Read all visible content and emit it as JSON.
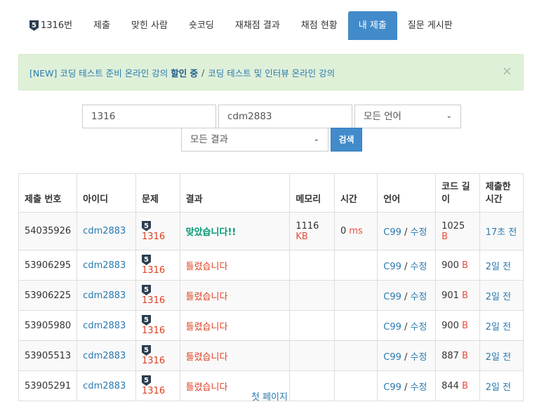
{
  "tabs": [
    {
      "label": "1316번",
      "badge": "5"
    },
    {
      "label": "제출"
    },
    {
      "label": "맞힌 사람"
    },
    {
      "label": "숏코딩"
    },
    {
      "label": "재채점 결과"
    },
    {
      "label": "채점 현황"
    },
    {
      "label": "내 제출",
      "active": true
    },
    {
      "label": "질문 게시판"
    }
  ],
  "alert": {
    "prefix": "[NEW] 코딩 테스트 준비 온라인 강의 ",
    "highlight": "할인 중",
    "separator": "/",
    "second": "코딩 테스트 및 인터뷰 온라인 강의",
    "close": "×"
  },
  "search": {
    "problem_id": "1316",
    "user_id": "cdm2883",
    "language": "모든 언어",
    "result": "모든 결과",
    "button": "검색"
  },
  "table": {
    "headers": {
      "submission": "제출 번호",
      "user": "아이디",
      "problem": "문제",
      "result": "결과",
      "memory": "메모리",
      "time": "시간",
      "language": "언어",
      "code_length_1": "코드 길",
      "code_length_2": "이",
      "submitted_1": "제출한",
      "submitted_2": "시간"
    },
    "rows": [
      {
        "id": "54035926",
        "user": "cdm2883",
        "badge": "5",
        "problem": "1316",
        "result": "맞았습니다!!",
        "memory": "1116",
        "memory_unit": "KB",
        "time": "0",
        "time_unit": "ms",
        "lang": "C99",
        "edit": "수정",
        "length": "1025",
        "length_unit": "B",
        "submitted": "17초 전"
      },
      {
        "id": "53906295",
        "user": "cdm2883",
        "badge": "5",
        "problem": "1316",
        "result": "틀렸습니다",
        "memory": "",
        "memory_unit": "",
        "time": "",
        "time_unit": "",
        "lang": "C99",
        "edit": "수정",
        "length": "900",
        "length_unit": "B",
        "submitted": "2일 전"
      },
      {
        "id": "53906225",
        "user": "cdm2883",
        "badge": "5",
        "problem": "1316",
        "result": "틀렸습니다",
        "memory": "",
        "memory_unit": "",
        "time": "",
        "time_unit": "",
        "lang": "C99",
        "edit": "수정",
        "length": "901",
        "length_unit": "B",
        "submitted": "2일 전"
      },
      {
        "id": "53905980",
        "user": "cdm2883",
        "badge": "5",
        "problem": "1316",
        "result": "틀렸습니다",
        "memory": "",
        "memory_unit": "",
        "time": "",
        "time_unit": "",
        "lang": "C99",
        "edit": "수정",
        "length": "900",
        "length_unit": "B",
        "submitted": "2일 전"
      },
      {
        "id": "53905513",
        "user": "cdm2883",
        "badge": "5",
        "problem": "1316",
        "result": "틀렸습니다",
        "memory": "",
        "memory_unit": "",
        "time": "",
        "time_unit": "",
        "lang": "C99",
        "edit": "수정",
        "length": "887",
        "length_unit": "B",
        "submitted": "2일 전"
      },
      {
        "id": "53905291",
        "user": "cdm2883",
        "badge": "5",
        "problem": "1316",
        "result": "틀렸습니다",
        "memory": "",
        "memory_unit": "",
        "time": "",
        "time_unit": "",
        "lang": "C99",
        "edit": "수정",
        "length": "844",
        "length_unit": "B",
        "submitted": "2일 전"
      }
    ]
  },
  "pagination": {
    "first_page": "첫 페이지"
  },
  "colors": {
    "accent": "#428bca",
    "accepted": "#009874",
    "wrong": "#dd4124",
    "link": "#2a7ab0",
    "alert_bg": "#dff0d8"
  }
}
